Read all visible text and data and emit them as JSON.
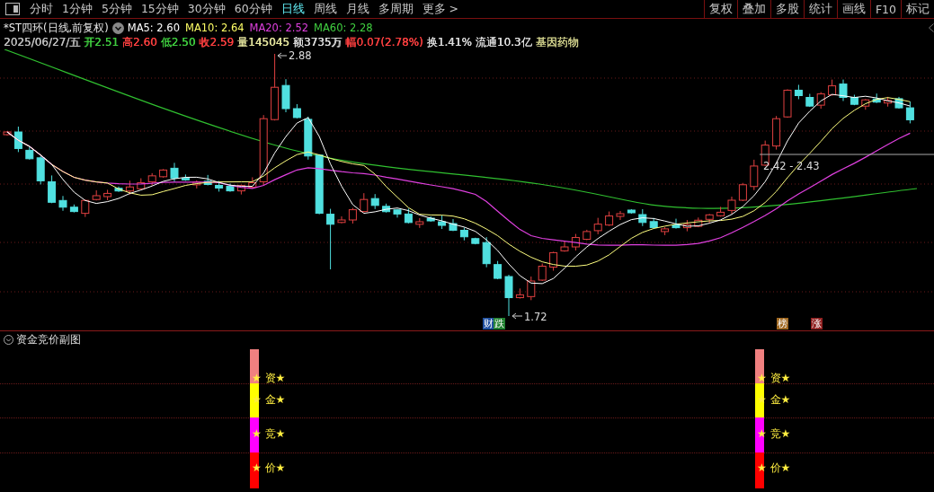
{
  "toolbar": {
    "periods": [
      {
        "label": "分时",
        "selected": false
      },
      {
        "label": "1分钟",
        "selected": false
      },
      {
        "label": "5分钟",
        "selected": false
      },
      {
        "label": "15分钟",
        "selected": false
      },
      {
        "label": "30分钟",
        "selected": false
      },
      {
        "label": "60分钟",
        "selected": false
      },
      {
        "label": "日线",
        "selected": true
      },
      {
        "label": "周线",
        "selected": false
      },
      {
        "label": "月线",
        "selected": false
      },
      {
        "label": "多周期",
        "selected": false
      },
      {
        "label": "更多 >",
        "selected": false
      }
    ],
    "buttons": [
      "复权",
      "叠加",
      "多股",
      "统计",
      "画线",
      "F10",
      "标记"
    ]
  },
  "stock_title": "*ST四环(日线,前复权)",
  "moving_averages": [
    {
      "text": "MA5: 2.60",
      "color": "#ffffff"
    },
    {
      "text": "MA10: 2.64",
      "color": "#ffff66"
    },
    {
      "text": "MA20: 2.52",
      "color": "#e040e0"
    },
    {
      "text": "MA60: 2.28",
      "color": "#40d040"
    }
  ],
  "quote": [
    {
      "text": "2025/06/27/五",
      "color": "#c0c0c0"
    },
    {
      "text": "开2.51",
      "color": "#40d040"
    },
    {
      "text": "高2.60",
      "color": "#ff4040"
    },
    {
      "text": "低2.50",
      "color": "#40d040"
    },
    {
      "text": "收2.59",
      "color": "#ff4040"
    },
    {
      "text": "量145045",
      "color": "#e8e8a0"
    },
    {
      "text": "额3735万",
      "color": "#e0e0e0"
    },
    {
      "text": "幅0.07(2.78%)",
      "color": "#ff4040"
    },
    {
      "text": "换1.41%",
      "color": "#e0e0e0"
    },
    {
      "text": "流通10.3亿",
      "color": "#e0e0e0"
    },
    {
      "text": "基因药物",
      "color": "#d8d890"
    }
  ],
  "main_chart": {
    "high_label": "2.88",
    "low_label": "1.72",
    "range_label": "2.42 - 2.43",
    "tags": [
      {
        "text": "财",
        "color": "#2050a0"
      },
      {
        "text": "跌",
        "color": "#208030"
      },
      {
        "text": "榜",
        "color": "#a06820"
      },
      {
        "text": "涨",
        "color": "#902020"
      }
    ]
  },
  "sub_chart": {
    "title": "资金竞价副图",
    "columns": [
      {
        "segments": [
          {
            "label": "★ 资★",
            "color": "#f08080"
          },
          {
            "label": "★ 金★",
            "color": "#ffff00"
          },
          {
            "label": "★ 竞★",
            "color": "#ff00ff"
          },
          {
            "label": "★ 价★",
            "color": "#ff0000"
          }
        ]
      },
      {
        "segments": [
          {
            "label": "★ 资★",
            "color": "#f08080"
          },
          {
            "label": "★ 金★",
            "color": "#ffff00"
          },
          {
            "label": "★ 竞★",
            "color": "#ff00ff"
          },
          {
            "label": "★ 价★",
            "color": "#ff0000"
          }
        ]
      }
    ]
  }
}
